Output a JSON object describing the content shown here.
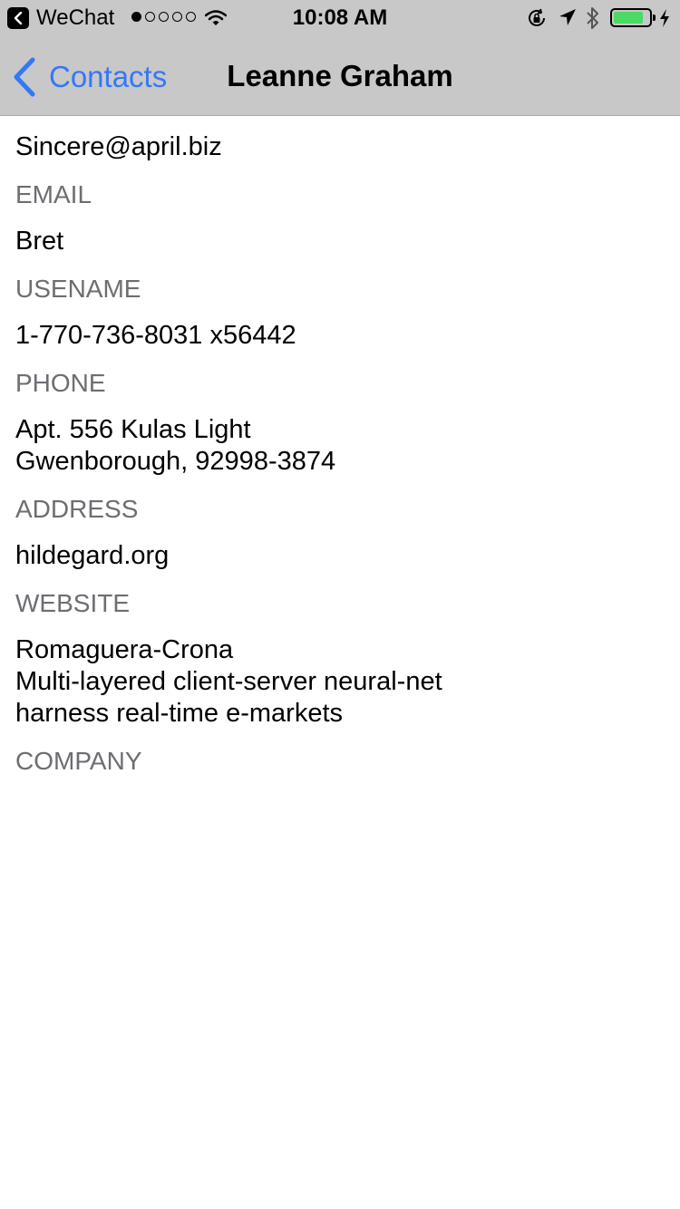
{
  "status_bar": {
    "app": "WeChat",
    "time": "10:08 AM",
    "signal_strength": 1,
    "signal_max": 5,
    "battery_level": 0.9,
    "icons": [
      "back-to-app-icon",
      "wifi-icon",
      "rotation-lock-icon",
      "location-icon",
      "bluetooth-icon",
      "battery-icon",
      "charging-bolt-icon"
    ]
  },
  "nav": {
    "back_label": "Contacts",
    "title": "Leanne Graham"
  },
  "fields": [
    {
      "value": "Sincere@april.biz",
      "label": "EMAIL"
    },
    {
      "value": "Bret",
      "label": "USENAME"
    },
    {
      "value": "1-770-736-8031 x56442",
      "label": "PHONE"
    },
    {
      "value": "Apt. 556 Kulas Light\nGwenborough, 92998-3874",
      "label": "ADDRESS"
    },
    {
      "value": "hildegard.org",
      "label": "WEBSITE"
    },
    {
      "value": "Romaguera-Crona\nMulti-layered client-server neural-net\nharness real-time e-markets",
      "label": "COMPANY"
    }
  ],
  "colors": {
    "accent": "#3478f6",
    "label": "#6d6d72",
    "bar": "#c8c8c8",
    "battery": "#4cd964"
  }
}
